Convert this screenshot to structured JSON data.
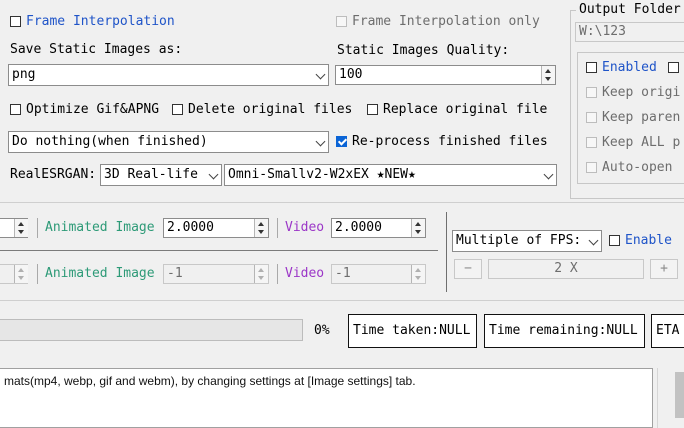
{
  "frame_interpolation": {
    "label": "Frame Interpolation",
    "only_label": "Frame Interpolation only"
  },
  "static_images": {
    "save_as_label": "Save Static Images as:",
    "format_value": "png",
    "quality_label": "Static Images Quality:",
    "quality_value": "100"
  },
  "options": {
    "optimize_gif": "Optimize Gif&APNG",
    "delete_original": "Delete original files",
    "replace_original": "Replace original file",
    "finish_action": "Do nothing(when finished)",
    "reprocess_finished": "Re-process finished files"
  },
  "realesrgan": {
    "label": "RealESRGAN:",
    "model_type": "3D Real-life",
    "model_name": "Omni-Smallv2-W2xEX ★NEW★"
  },
  "output_folder": {
    "title": "Output Folder",
    "path": "W:\\123",
    "enabled_label": "Enabled",
    "keep_origin": "Keep origi",
    "keep_parent": "Keep paren",
    "keep_all": "Keep ALL p",
    "auto_open": "Auto-open"
  },
  "scale_row1": {
    "animated_label": "Animated Image",
    "animated_value": "2.0000",
    "video_label": "Video",
    "video_value": "2.0000"
  },
  "scale_row2": {
    "animated_label": "Animated Image",
    "animated_value": "-1",
    "video_label": "Video",
    "video_value": "-1"
  },
  "fps": {
    "mode": "Multiple of FPS:",
    "enable_label": "Enable",
    "minus": "−",
    "value": "2 X",
    "plus": "+"
  },
  "progress": {
    "percent_text": "0%",
    "fraction": 0,
    "time_taken": "Time taken:NULL",
    "time_remaining": "Time remaining:NULL",
    "eta": "ETA"
  },
  "log": {
    "text": "mats(mp4, webp, gif and webm), by changing settings at [Image settings] tab."
  },
  "colors": {
    "blue_label": "#1f54c8",
    "animated_label": "#2d9a77",
    "video_label": "#9b36c7"
  }
}
